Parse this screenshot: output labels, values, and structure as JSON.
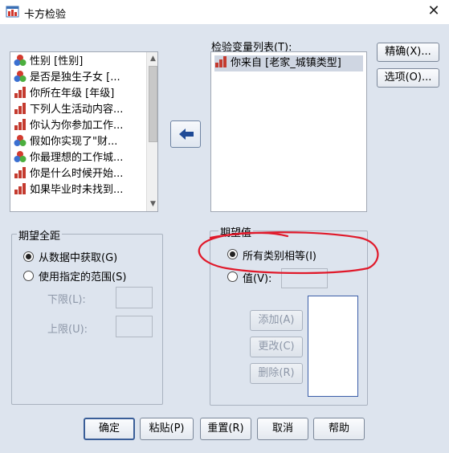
{
  "window": {
    "title": "卡方检验",
    "close_glyph": "✕"
  },
  "variable_list": {
    "items": [
      {
        "label": "性别 [性别]",
        "icon": "nominal-icon"
      },
      {
        "label": "是否是独生子女 [...",
        "icon": "nominal-icon"
      },
      {
        "label": "你所在年级 [年级]",
        "icon": "ordinal-icon"
      },
      {
        "label": "下列人生活动内容...",
        "icon": "ordinal-icon"
      },
      {
        "label": "你认为你参加工作...",
        "icon": "ordinal-icon"
      },
      {
        "label": "假如你实现了\"财...",
        "icon": "nominal-icon"
      },
      {
        "label": "你最理想的工作城...",
        "icon": "nominal-icon"
      },
      {
        "label": "你是什么时候开始...",
        "icon": "ordinal-icon"
      },
      {
        "label": "如果毕业时未找到...",
        "icon": "ordinal-icon"
      }
    ]
  },
  "test_variables": {
    "label": "检验变量列表(T):",
    "items": [
      {
        "label": "你来自 [老家_城镇类型]",
        "icon": "ordinal-icon"
      }
    ]
  },
  "side_buttons": {
    "exact": "精确(X)...",
    "options": "选项(O)..."
  },
  "expected_range": {
    "title": "期望全距",
    "opt_from_data": "从数据中获取(G)",
    "opt_specified": "使用指定的范围(S)",
    "lower_label": "下限(L):",
    "upper_label": "上限(U):",
    "selected": "from_data"
  },
  "expected_values": {
    "title": "期望值",
    "opt_all_equal": "所有类别相等(I)",
    "opt_values": "值(V):",
    "add": "添加(A)",
    "change": "更改(C)",
    "remove": "删除(R)",
    "selected": "all_equal"
  },
  "footer": {
    "ok": "确定",
    "paste": "粘贴(P)",
    "reset": "重置(R)",
    "cancel": "取消",
    "help": "帮助"
  },
  "colors": {
    "background": "#dde4ee",
    "annotation": "#e0192a",
    "ordinal_bar": "#c43a2e",
    "nominal_red": "#d33b2f",
    "nominal_blue": "#3b6fd1",
    "nominal_green": "#4caf3e"
  }
}
